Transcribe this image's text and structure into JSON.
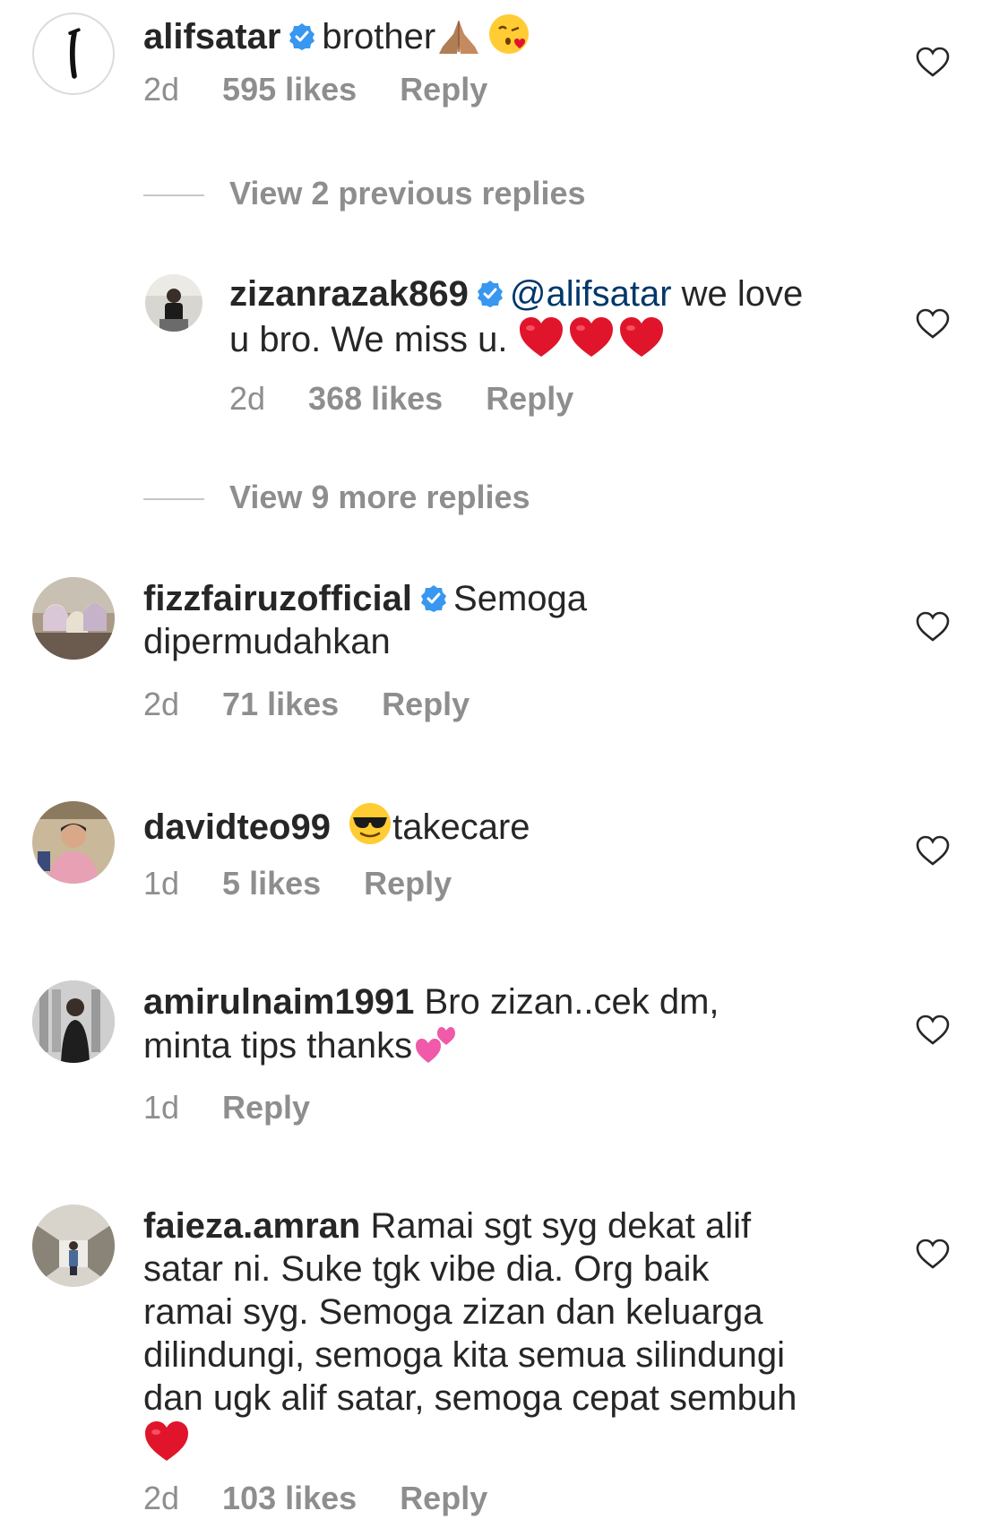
{
  "colors": {
    "text": "#262626",
    "meta": "#8e8e8e",
    "mention": "#00376b",
    "verified": "#3897f0",
    "heart_emoji": "#e0152b"
  },
  "comments": [
    {
      "username": "alifsatar",
      "verified": true,
      "text": "brother",
      "emojis": [
        "folded-hands-emoji",
        "kissing-heart-emoji"
      ],
      "time": "2d",
      "likes": "595 likes",
      "reply": "Reply",
      "avatar_icon": "alif-letter-avatar-icon"
    },
    {
      "view_previous": "View 2 previous replies"
    },
    {
      "username": "zizanrazak869",
      "verified": true,
      "mention": "@alifsatar",
      "text_line1": " we love",
      "text_line2": "u bro. We miss u.",
      "emojis": [
        "red-heart-emoji",
        "red-heart-emoji",
        "red-heart-emoji"
      ],
      "time": "2d",
      "likes": "368 likes",
      "reply": "Reply"
    },
    {
      "view_more": "View 9 more replies"
    },
    {
      "username": "fizzfairuzofficial",
      "verified": true,
      "text_line1": "Semoga",
      "text_line2": "dipermudahkan",
      "time": "2d",
      "likes": "71 likes",
      "reply": "Reply"
    },
    {
      "username": "davidteo99",
      "verified": false,
      "emojis": [
        "sunglasses-emoji"
      ],
      "text": "takecare",
      "time": "1d",
      "likes": "5 likes",
      "reply": "Reply"
    },
    {
      "username": "amirulnaim1991",
      "verified": false,
      "text_line1": " Bro zizan..cek dm,",
      "text_line2": "minta tips thanks",
      "emojis": [
        "two-hearts-emoji"
      ],
      "time": "1d",
      "reply": "Reply"
    },
    {
      "username": "faieza.amran",
      "verified": false,
      "text_line1": " Ramai sgt syg dekat alif",
      "text_line2": "satar ni. Suke tgk vibe dia. Org baik",
      "text_line3": "ramai syg. Semoga zizan dan keluarga",
      "text_line4": "dilindungi, semoga kita semua silindungi",
      "text_line5": "dan ugk alif satar, semoga cepat sembuh",
      "emojis": [
        "red-heart-emoji"
      ],
      "time": "2d",
      "likes": "103 likes",
      "reply": "Reply"
    }
  ]
}
